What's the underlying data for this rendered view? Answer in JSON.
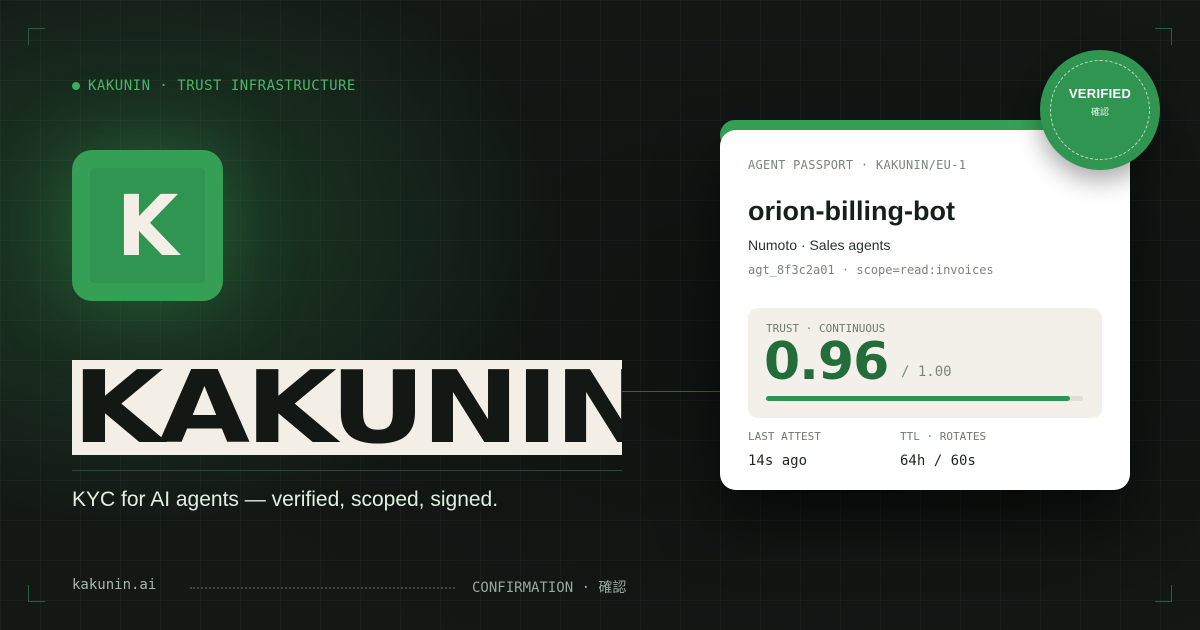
{
  "eyebrow": {
    "text": "KAKUNIN · TRUST INFRASTRUCTURE"
  },
  "logo": {
    "letter": "K"
  },
  "wordmark": {
    "text": "KAKUNIN"
  },
  "tagline": {
    "text": "KYC for AI agents — verified, scoped, signed."
  },
  "footer": {
    "domain": "kakunin.ai",
    "confirmation": "CONFIRMATION · 確認"
  },
  "card": {
    "eyebrow": "AGENT PASSPORT · KAKUNIN/EU-1",
    "agent_name": "orion-billing-bot",
    "org": "Numoto · Sales agents",
    "meta": "agt_8f3c2a01 · scope=read:invoices",
    "trust": {
      "label": "TRUST · CONTINUOUS",
      "score": "0.96",
      "max": "/ 1.00",
      "fraction": 0.96
    },
    "stats": [
      {
        "label": "LAST ATTEST",
        "value": "14s ago"
      },
      {
        "label": "TTL · ROTATES",
        "value": "64h / 60s"
      }
    ]
  },
  "badge": {
    "title": "VERIFIED",
    "subtitle": "確認"
  },
  "colors": {
    "background": "#131815",
    "accent": "#35a055",
    "accent_dark": "#236c3c",
    "cream": "#f3efe6"
  }
}
